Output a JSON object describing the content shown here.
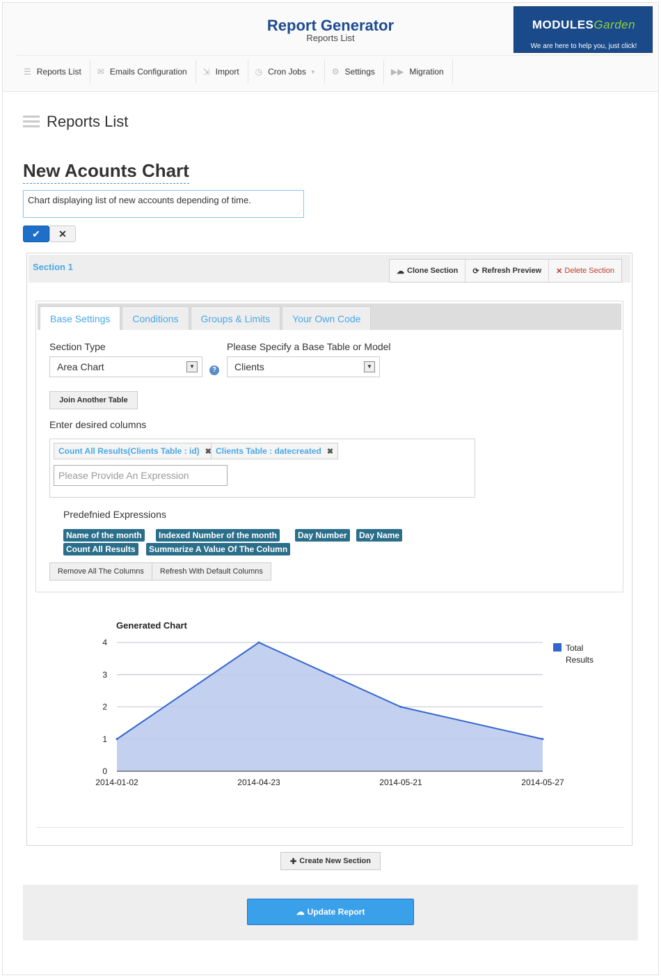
{
  "header": {
    "title": "Report Generator",
    "subtitle": "Reports List",
    "brand": {
      "logo_main": "MODULES",
      "logo_accent": "Garden",
      "tagline": "We are here to help you, just click!"
    }
  },
  "nav": [
    {
      "label": "Reports List",
      "icon": "list-icon"
    },
    {
      "label": "Emails Configuration",
      "icon": "envelope-icon"
    },
    {
      "label": "Import",
      "icon": "import-icon"
    },
    {
      "label": "Cron Jobs",
      "icon": "clock-icon"
    },
    {
      "label": "Settings",
      "icon": "gears-icon"
    },
    {
      "label": "Migration",
      "icon": "forward-icon"
    }
  ],
  "page": {
    "heading": "Reports List",
    "report_title": "New Acounts Chart",
    "description": "Chart displaying list of new accounts depending of time."
  },
  "section": {
    "title": "Section 1",
    "buttons": {
      "clone": "Clone Section",
      "refresh": "Refresh Preview",
      "delete": "Delete Section"
    },
    "tabs": [
      "Base Settings",
      "Conditions",
      "Groups & Limits",
      "Your Own Code"
    ],
    "section_type_label": "Section Type",
    "section_type_value": "Area Chart",
    "base_table_label": "Please Specify a Base Table or Model",
    "base_table_value": "Clients",
    "join_button": "Join Another Table",
    "columns_label": "Enter desired columns",
    "columns": [
      "Count All Results(Clients Table : id)",
      "Clients Table : datecreated"
    ],
    "expression_placeholder": "Please Provide An Expression",
    "predefined_label": "Predefnied Expressions",
    "predefined": [
      "Name of the month",
      "Indexed Number of the month",
      "Day Number",
      "Day Name",
      "Count All Results",
      "Summarize A Value Of The Column"
    ],
    "remove_columns": "Remove All The Columns",
    "refresh_columns": "Refresh With Default Columns"
  },
  "chart_data": {
    "type": "area",
    "title": "Generated Chart",
    "categories": [
      "2014-01-02",
      "2014-04-23",
      "2014-05-21",
      "2014-05-27"
    ],
    "series": [
      {
        "name": "Total Results",
        "values": [
          1,
          4,
          2,
          1
        ]
      }
    ],
    "ylim": [
      0,
      4
    ],
    "yticks": [
      "0",
      "1",
      "2",
      "3",
      "4"
    ],
    "legend": "right",
    "grid": true,
    "colors": {
      "line": "#3366cc",
      "fill": "#c4d0f0"
    }
  },
  "footer": {
    "create_section": "Create New Section",
    "update_report": "Update Report"
  }
}
